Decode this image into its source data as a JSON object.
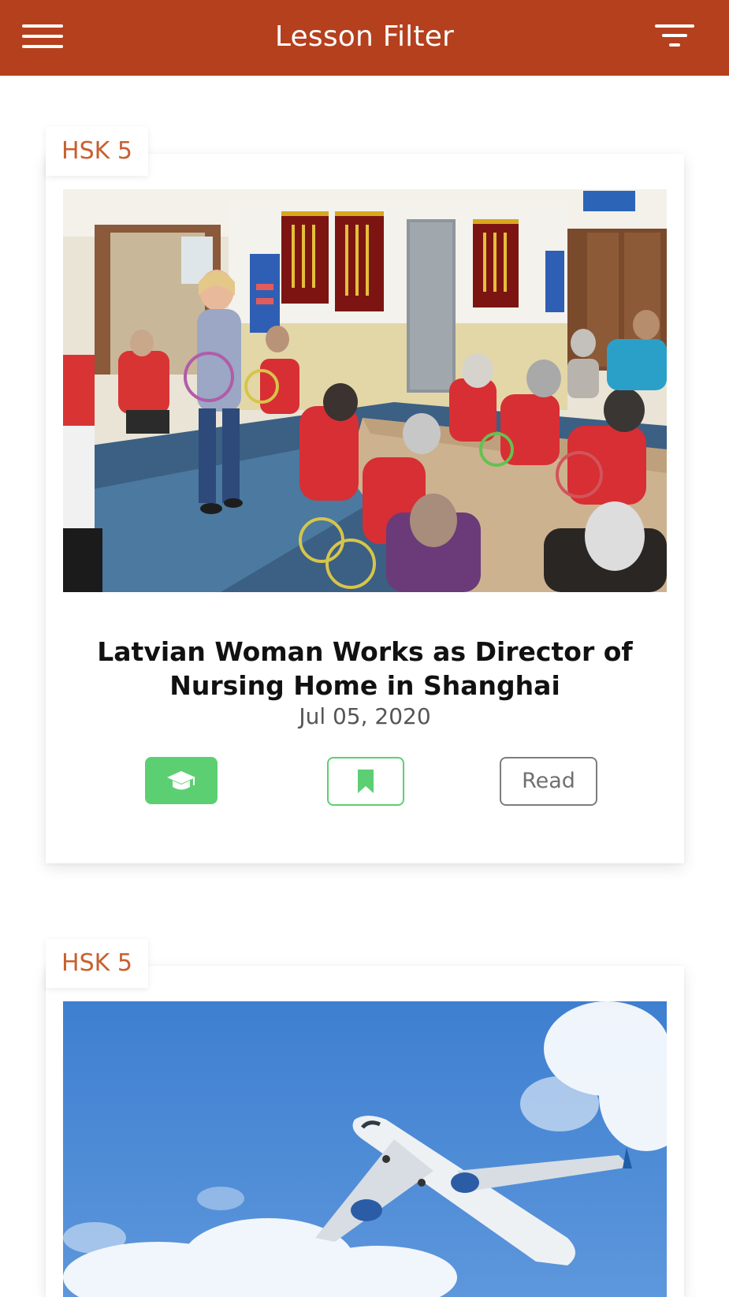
{
  "header": {
    "title": "Lesson Filter",
    "menu_icon": "hamburger-menu-icon",
    "filter_icon": "filter-icon",
    "background_color": "#b5401d"
  },
  "lessons": [
    {
      "level": "HSK 5",
      "title": "Latvian Woman Works as Director of Nursing Home in Shanghai",
      "date": "Jul 05, 2020",
      "image": "Woman leading ring-toss activity with elderly residents in red shirts at a nursing home",
      "actions": {
        "learn_icon": "graduation-cap-icon",
        "bookmark_icon": "bookmark-icon",
        "read_label": "Read"
      }
    },
    {
      "level": "HSK 5",
      "image": "Passenger airplane flying in blue sky with clouds"
    }
  ],
  "colors": {
    "accent": "#b5401d",
    "tag_text": "#c8602f",
    "green": "#5ccf73",
    "read_border": "#7d7d7d"
  }
}
